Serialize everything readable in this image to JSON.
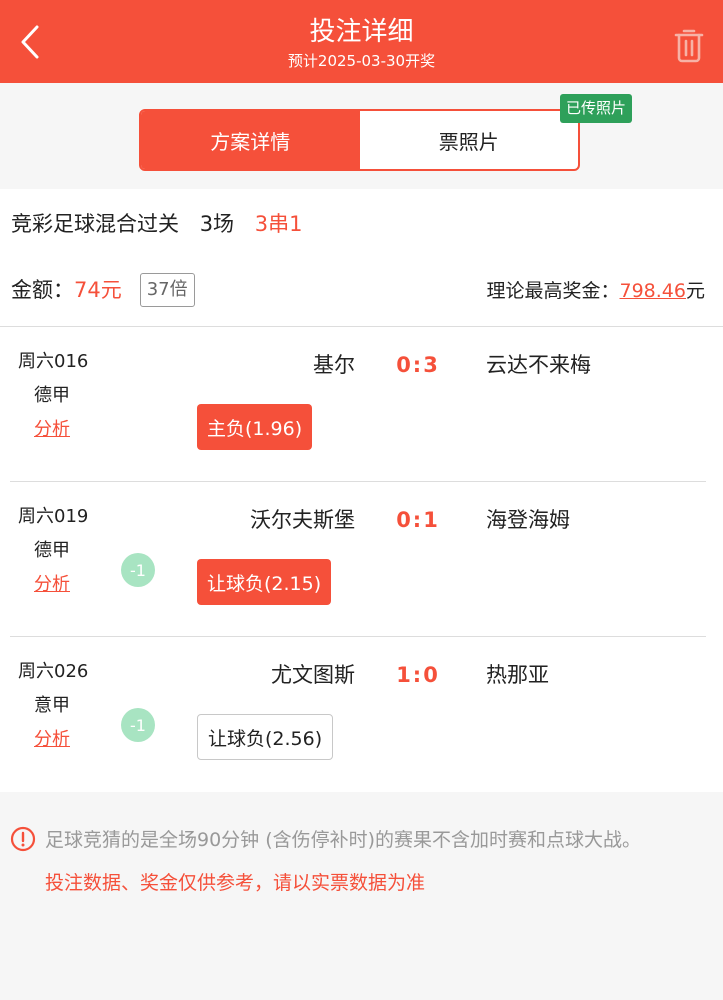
{
  "header": {
    "title": "投注详细",
    "subtitle": "预计2025-03-30开奖",
    "back_icon": "chevron-left-icon",
    "delete_icon": "trash-icon"
  },
  "tabs": [
    {
      "label": "方案详情",
      "active": true
    },
    {
      "label": "票照片",
      "active": false
    }
  ],
  "photo_badge": "已传照片",
  "summary": {
    "play_type": "竞彩足球混合过关",
    "matches": "3场",
    "pass_type": "3串1",
    "amount_label": "金额：",
    "amount": "74元",
    "multiplier": "37倍",
    "prize_label": "理论最高奖金：",
    "prize_value": "798.46",
    "prize_unit": "元"
  },
  "matches": [
    {
      "code": "周六016",
      "league": "德甲",
      "analysis": "分析",
      "home": "基尔",
      "score": "0:3",
      "away": "云达不来梅",
      "handicap": "",
      "pick": "主负(1.96)",
      "pick_selected": true
    },
    {
      "code": "周六019",
      "league": "德甲",
      "analysis": "分析",
      "home": "沃尔夫斯堡",
      "score": "0:1",
      "away": "海登海姆",
      "handicap": "-1",
      "pick": "让球负(2.15)",
      "pick_selected": true
    },
    {
      "code": "周六026",
      "league": "意甲",
      "analysis": "分析",
      "home": "尤文图斯",
      "score": "1:0",
      "away": "热那亚",
      "handicap": "-1",
      "pick": "让球负(2.56)",
      "pick_selected": false
    }
  ],
  "notice": {
    "icon": "alert-circle-icon",
    "line1": "足球竞猜的是全场90分钟 (含伤停补时)的赛果不含加时赛和点球大战。",
    "line2": "投注数据、奖金仅供参考，请以实票数据为准"
  },
  "colors": {
    "accent": "#f5503a",
    "badge": "#2ea05a",
    "handicap": "#a8e4c2"
  }
}
